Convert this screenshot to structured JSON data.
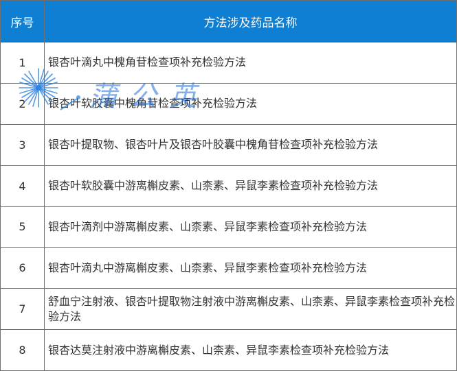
{
  "table": {
    "headers": [
      "序号",
      "方法涉及药品名称"
    ],
    "rows": [
      {
        "num": "1",
        "name": "银杏叶滴丸中槐角苷检查项补充检验方法"
      },
      {
        "num": "2",
        "name": "银杏叶软胶囊中槐角苷检查项补充检验方法"
      },
      {
        "num": "3",
        "name": "银杏叶提取物、银杏叶片及银杏叶胶囊中槐角苷检查项补充检验方法"
      },
      {
        "num": "4",
        "name": "银杏叶软胶囊中游离槲皮素、山柰素、异鼠李素检查项补充检验方法"
      },
      {
        "num": "5",
        "name": "银杏叶滴剂中游离槲皮素、山柰素、异鼠李素检查项补充检验方法"
      },
      {
        "num": "6",
        "name": "银杏叶滴丸中游离槲皮素、山柰素、异鼠李素检查项补充检验方法"
      },
      {
        "num": "7",
        "name": "舒血宁注射液、银杏叶提取物注射液中游离槲皮素、山柰素、异鼠李素检查项补充检验方法"
      },
      {
        "num": "8",
        "name": "银杏达莫注射液中游离槲皮素、山柰素、异鼠李素检查项补充检验方法"
      }
    ]
  },
  "watermark": {
    "text": "蒲公英",
    "color": "#1e6edc"
  }
}
